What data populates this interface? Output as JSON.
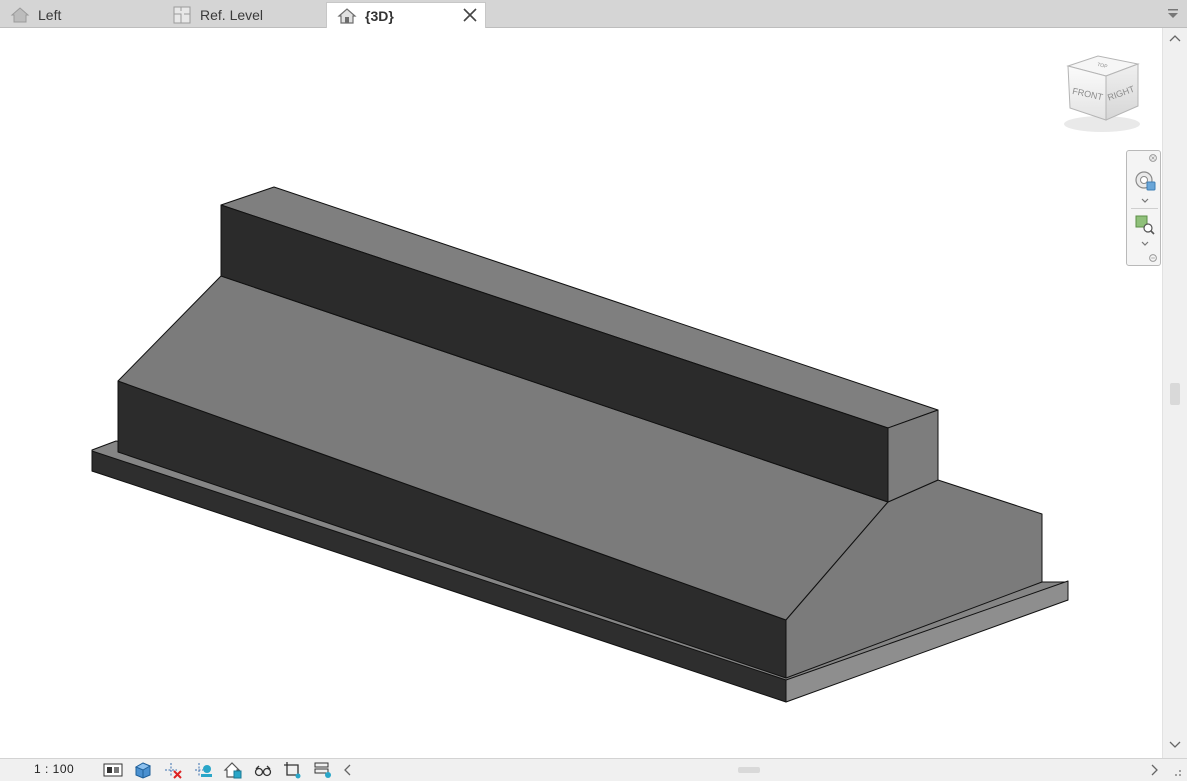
{
  "tabs": [
    {
      "label": "Left",
      "icon": "elevation-house-icon",
      "active": false
    },
    {
      "label": "Ref. Level",
      "icon": "floor-plan-icon",
      "active": false
    },
    {
      "label": "{3D}",
      "icon": "3d-house-icon",
      "active": true
    }
  ],
  "viewcube": {
    "front": "FRONT",
    "right": "RIGHT",
    "top": "TOP"
  },
  "navigation_bar": {
    "tools": [
      "full-navigation-wheel-icon",
      "zoom-region-icon"
    ]
  },
  "status_bar": {
    "scale": "1 : 100",
    "tools": [
      "detail-level-icon",
      "visual-style-icon",
      "sun-path-off-icon",
      "shadows-off-icon",
      "show-rendering-dialog-icon",
      "unlock-3d-view-icon",
      "crop-view-icon",
      "show-crop-region-icon"
    ]
  },
  "colors": {
    "tab_bar": "#d5d5d5",
    "active_tab": "#ffffff",
    "model_dark": "#2e2e2e",
    "model_mid": "#7c7c7c",
    "model_light": "#8a8a8a",
    "edge": "#111111",
    "status_bar": "#f0f0f0"
  }
}
